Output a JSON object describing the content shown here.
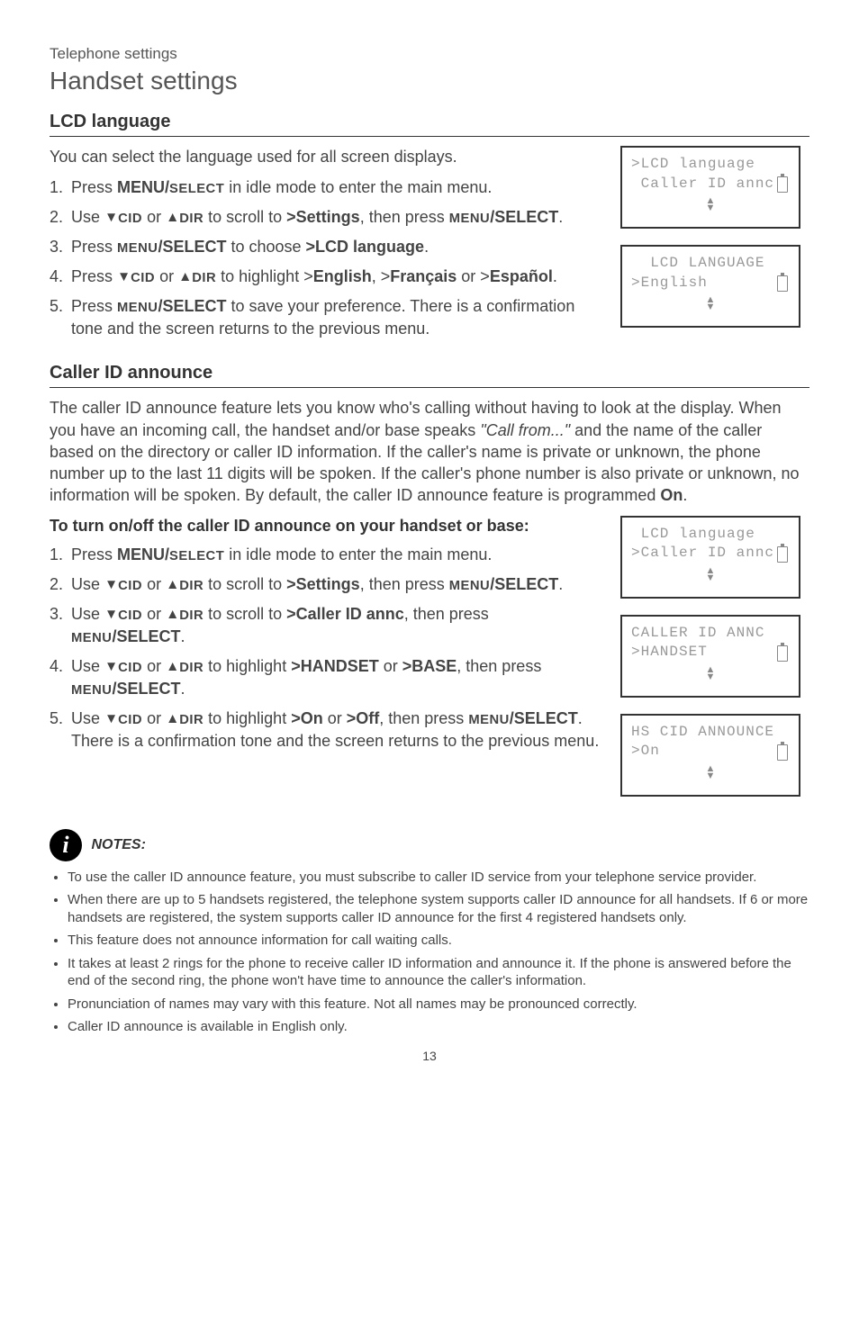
{
  "header": {
    "category": "Telephone settings",
    "title": "Handset settings"
  },
  "section1": {
    "heading": "LCD language",
    "intro": "You can select the language used for all screen displays.",
    "steps": {
      "s1a": "Press ",
      "s1b": "MENU/",
      "s1c": "SELECT",
      "s1d": " in idle mode to enter the main menu.",
      "s2a": "Use ",
      "s2_cid": "CID",
      "s2_or": " or ",
      "s2_dir": "DIR",
      "s2b": " to scroll to ",
      "s2c": ">Settings",
      "s2d": ", then press ",
      "s2e": "MENU",
      "s2f": "/SELECT",
      "s2g": ".",
      "s3a": "Press ",
      "s3b": "MENU",
      "s3c": "/SELECT",
      "s3d": " to choose ",
      "s3e": ">LCD language",
      "s3f": ".",
      "s4a": "Press ",
      "s4b": " to highlight >",
      "s4c": "English",
      "s4d": ", >",
      "s4e": "Français",
      "s4f": " or >",
      "s4g": "Español",
      "s4h": ".",
      "s5a": "Press ",
      "s5b": "MENU",
      "s5c": "/SELECT",
      "s5d": " to save your preference. There is a confirmation tone and the screen returns to the previous menu."
    },
    "lcd1": {
      "l1": ">LCD language",
      "l2": " Caller ID annc"
    },
    "lcd2": {
      "l1": "  LCD LANGUAGE",
      "l2": ">English"
    }
  },
  "section2": {
    "heading": "Caller ID announce",
    "para_parts": {
      "p1": "The caller ID announce feature lets you know who's calling without having to look at the display. When you have an incoming call, the handset and/or base speaks ",
      "p2": "\"Call from...\"",
      "p3": " and the name of the caller based on the directory or caller ID information. If the caller's name is private or unknown, the phone number up to the last 11 digits will be spoken. If the caller's phone number is also private or unknown, no information will be spoken. By default, the caller ID announce feature is programmed ",
      "p4": "On",
      "p5": "."
    },
    "subheading": "To turn on/off the caller ID announce on your handset or base:",
    "steps": {
      "s1a": "Press ",
      "s1b": "MENU/",
      "s1c": "SELECT",
      "s1d": " in idle mode to enter the main menu.",
      "s2a": "Use ",
      "s2b": " to scroll to ",
      "s2c": ">Settings",
      "s2d": ", then press ",
      "s2e": "MENU",
      "s2f": "/SELECT",
      "s2g": ".",
      "s3a": "Use ",
      "s3b": " to scroll to ",
      "s3c": ">Caller ID annc",
      "s3d": ", then press ",
      "s3e": "MENU",
      "s3f": "/SELECT",
      "s3g": ".",
      "s4a": "Use ",
      "s4b": " to highlight ",
      "s4c": ">HANDSET",
      "s4d": " or ",
      "s4e": ">BASE",
      "s4f": ", then press ",
      "s4g": "MENU",
      "s4h": "/SELECT",
      "s4i": ".",
      "s5a": "Use ",
      "s5b": " to highlight ",
      "s5c": ">On",
      "s5d": " or ",
      "s5e": ">Off",
      "s5f": ", then press ",
      "s5g": "MENU",
      "s5h": "/SELECT",
      "s5i": ". There is a confirmation tone and the screen returns to the previous menu."
    },
    "lcd1": {
      "l1": " LCD language",
      "l2": ">Caller ID annc"
    },
    "lcd2": {
      "l1": "CALLER ID ANNC",
      "l2": ">HANDSET"
    },
    "lcd3": {
      "l1": "HS CID ANNOUNCE",
      "l2": ">On"
    }
  },
  "notes": {
    "label": "NOTES:",
    "items": [
      "To use the caller ID announce feature, you must subscribe to caller ID service from your telephone service provider.",
      "When there are up to 5 handsets registered, the telephone system supports caller ID announce for all handsets. If 6 or more handsets are registered, the system supports caller ID announce for the first 4 registered handsets only.",
      "This feature does not announce information for call waiting calls.",
      "It takes at least 2 rings for the phone to receive caller ID information and announce it. If the phone is answered before the end of the second ring, the phone won't have time to announce the caller's information.",
      "Pronunciation of names may vary with this feature. Not all names may be pronounced correctly.",
      "Caller ID announce is available in English only."
    ]
  },
  "labels": {
    "cid": "CID",
    "dir": "DIR"
  },
  "page": "13"
}
